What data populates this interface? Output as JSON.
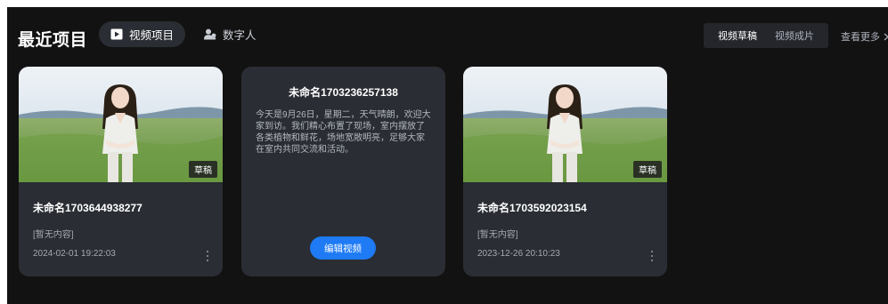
{
  "header": {
    "title": "最近项目",
    "tabs": [
      {
        "label": "视频项目",
        "icon": "video-play-icon",
        "active": true
      },
      {
        "label": "数字人",
        "icon": "digital-human-icon",
        "active": false
      }
    ],
    "sub_tabs": [
      {
        "label": "视频草稿",
        "active": true
      },
      {
        "label": "视频成片",
        "active": false
      }
    ],
    "more_label": "查看更多",
    "more_icon": "chevron-right-icon"
  },
  "cards": [
    {
      "title": "未命名1703644938277",
      "content": "[暂无内容]",
      "date": "2024-02-01 19:22:03",
      "badge": "草稿",
      "thumbnail": "digital-human-presenter-grassland"
    },
    {
      "title": "未命名1703236257138",
      "script": "今天是9月26日，星期二，天气晴朗，欢迎大家到访。我们精心布置了现场，室内摆放了各类植物和鲜花，场地宽敞明亮，足够大家在室内共同交流和活动。",
      "button_label": "编辑视频"
    },
    {
      "title": "未命名1703592023154",
      "content": "[暂无内容]",
      "date": "2023-12-26 20:10:23",
      "badge": "草稿",
      "thumbnail": "digital-human-presenter-grassland"
    }
  ],
  "colors": {
    "background": "#121212",
    "card": "#2a2d33",
    "accent": "#1e7bf5"
  }
}
